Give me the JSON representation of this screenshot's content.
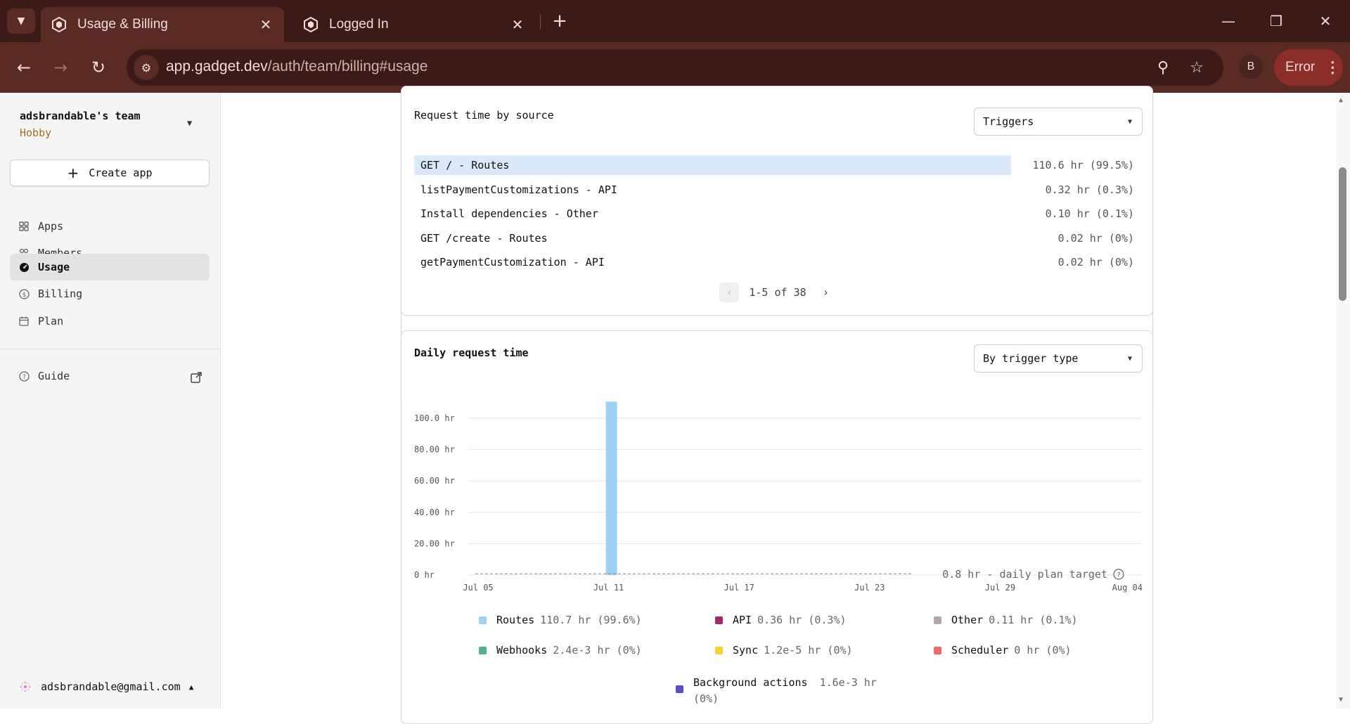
{
  "browser": {
    "tabs": [
      {
        "title": "Usage & Billing",
        "active": true
      },
      {
        "title": "Logged In",
        "active": false
      }
    ],
    "url_host": "app.gadget.dev",
    "url_path": "/auth/team/billing#usage",
    "profile_initial": "B",
    "error_label": "Error"
  },
  "sidebar": {
    "team_name": "adsbrandable's team",
    "team_plan": "Hobby",
    "create_app_label": "Create app",
    "nav": [
      {
        "label": "Apps",
        "icon": "grid-icon"
      },
      {
        "label": "Members",
        "icon": "members-icon"
      },
      {
        "label": "Usage",
        "icon": "gauge-icon",
        "active": true
      },
      {
        "label": "Billing",
        "icon": "dollar-icon"
      },
      {
        "label": "Plan",
        "icon": "calendar-icon"
      }
    ],
    "guide_label": "Guide",
    "user_email": "adsbrandable@gmail.com"
  },
  "request_time_by_source": {
    "title": "Request time by source",
    "select_value": "Triggers",
    "rows": [
      {
        "label": "GET / - Routes",
        "value": "110.6 hr (99.5%)"
      },
      {
        "label": "listPaymentCustomizations - API",
        "value": "0.32 hr (0.3%)"
      },
      {
        "label": "Install dependencies - Other",
        "value": "0.10 hr (0.1%)"
      },
      {
        "label": "GET /create - Routes",
        "value": "0.02 hr (0%)"
      },
      {
        "label": "getPaymentCustomization - API",
        "value": "0.02 hr (0%)"
      }
    ],
    "pagination": "1-5 of 38"
  },
  "daily_request_time": {
    "title": "Daily request time",
    "select_value": "By trigger type",
    "target_label": "0.8 hr - daily plan target",
    "legend": [
      {
        "name": "Routes",
        "value": "110.7 hr (99.6%)",
        "color": "#9fd0f5"
      },
      {
        "name": "API",
        "value": "0.36 hr (0.3%)",
        "color": "#a3296a"
      },
      {
        "name": "Other",
        "value": "0.11 hr (0.1%)",
        "color": "#b3a7a7"
      },
      {
        "name": "Webhooks",
        "value": "2.4e-3 hr (0%)",
        "color": "#4fb38c"
      },
      {
        "name": "Sync",
        "value": "1.2e-5 hr (0%)",
        "color": "#f5d22e"
      },
      {
        "name": "Scheduler",
        "value": "0 hr (0%)",
        "color": "#f06a6a"
      },
      {
        "name": "Background actions",
        "value": "1.6e-3 hr",
        "value2": "(0%)",
        "color": "#5b4fc9"
      }
    ]
  },
  "chart_data": {
    "type": "bar",
    "title": "Daily request time",
    "x_tick_labels": [
      "Jul 05",
      "Jul 11",
      "Jul 17",
      "Jul 23",
      "Jul 29",
      "Aug 04"
    ],
    "y_tick_labels": [
      "0 hr",
      "20.00 hr",
      "40.00 hr",
      "60.00 hr",
      "80.00 hr",
      "100.0 hr"
    ],
    "ylim": [
      0,
      110
    ],
    "x_start_date": "2024-07-05",
    "days": 31,
    "series": [
      {
        "name": "Routes",
        "color": "#9fd0f5",
        "points": [
          {
            "x": "Jul 11",
            "y": 110.6
          }
        ]
      }
    ],
    "target_line": {
      "y": 0.8,
      "label": "0.8 hr - daily plan target"
    },
    "grid": true
  }
}
